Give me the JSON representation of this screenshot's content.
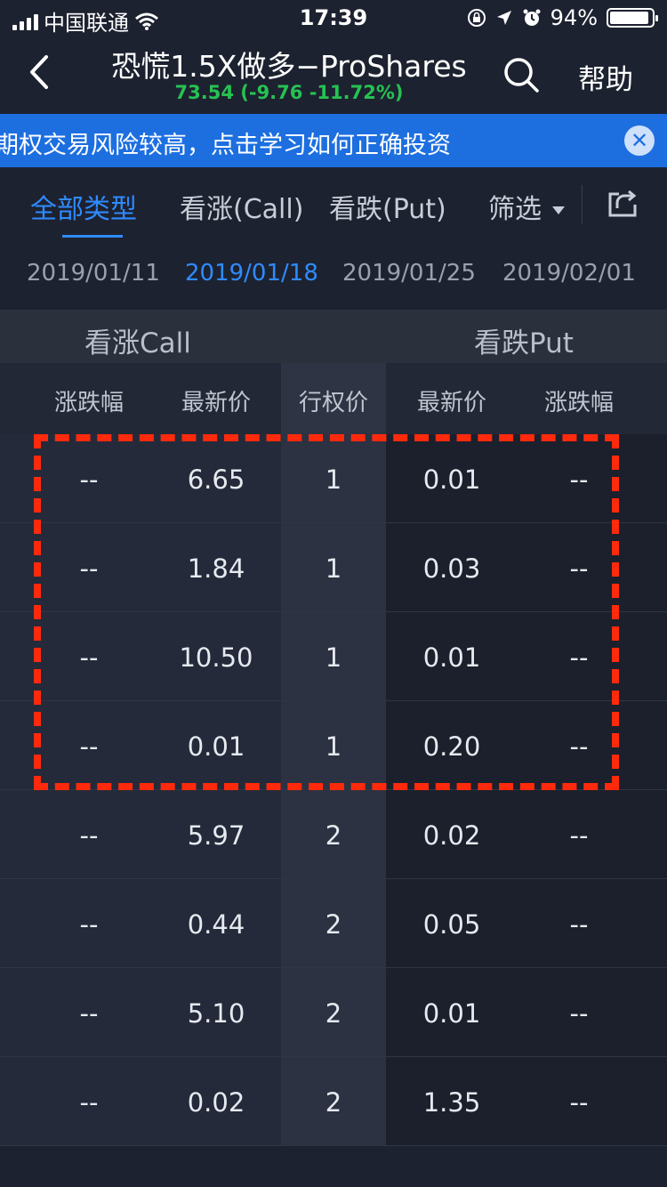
{
  "status_bar": {
    "carrier": "中国联通",
    "time": "17:39",
    "battery": "94%",
    "battery_level": 0.94
  },
  "header": {
    "title": "恐慌1.5X做多−ProShares",
    "quote": "73.54 (-9.76 -11.72%)",
    "quote_color": "#26c252",
    "help_label": "帮助"
  },
  "banner": {
    "text": "期权交易风险较高，点击学习如何正确投资",
    "background": "#1d6fe0"
  },
  "tabs": [
    {
      "label": "全部类型",
      "active": true
    },
    {
      "label": "看涨(Call)",
      "active": false
    },
    {
      "label": "看跌(Put)",
      "active": false
    }
  ],
  "filter_label": "筛选",
  "dates": [
    {
      "label": "2019/01/11",
      "active": false
    },
    {
      "label": "2019/01/18",
      "active": true
    },
    {
      "label": "2019/01/25",
      "active": false
    },
    {
      "label": "2019/02/01",
      "active": false
    }
  ],
  "section_headers": {
    "call": "看涨Call",
    "put": "看跌Put"
  },
  "columns": {
    "call_change": "涨跌幅",
    "call_price": "最新价",
    "strike": "行权价",
    "put_price": "最新价",
    "put_change": "涨跌幅"
  },
  "rows": [
    {
      "call_change": "--",
      "call_price": "6.65",
      "strike": "1",
      "put_price": "0.01",
      "put_change": "--"
    },
    {
      "call_change": "--",
      "call_price": "1.84",
      "strike": "1",
      "put_price": "0.03",
      "put_change": "--"
    },
    {
      "call_change": "--",
      "call_price": "10.50",
      "strike": "1",
      "put_price": "0.01",
      "put_change": "--"
    },
    {
      "call_change": "--",
      "call_price": "0.01",
      "strike": "1",
      "put_price": "0.20",
      "put_change": "--"
    },
    {
      "call_change": "--",
      "call_price": "5.97",
      "strike": "2",
      "put_price": "0.02",
      "put_change": "--"
    },
    {
      "call_change": "--",
      "call_price": "0.44",
      "strike": "2",
      "put_price": "0.05",
      "put_change": "--"
    },
    {
      "call_change": "--",
      "call_price": "5.10",
      "strike": "2",
      "put_price": "0.01",
      "put_change": "--"
    },
    {
      "call_change": "--",
      "call_price": "0.02",
      "strike": "2",
      "put_price": "1.35",
      "put_change": "--"
    }
  ],
  "accent_color": "#2f8bff",
  "highlight_color": "#ff2a0c"
}
